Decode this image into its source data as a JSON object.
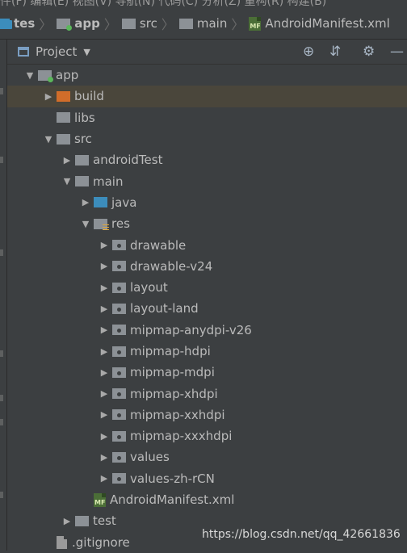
{
  "menubar": {
    "partial_text": "件(F)   编辑(E)   视图(V)   导航(N)   代码(C)   分析(Z)   重构(R)   构建(B)"
  },
  "breadcrumb": [
    {
      "label": "tes",
      "icon": "folder-icon",
      "bold": true
    },
    {
      "label": "app",
      "icon": "module-folder-icon",
      "bold": true
    },
    {
      "label": "src",
      "icon": "folder-icon",
      "bold": false
    },
    {
      "label": "main",
      "icon": "folder-icon",
      "bold": false
    },
    {
      "label": "AndroidManifest.xml",
      "icon": "manifest-file-icon",
      "bold": false
    }
  ],
  "panel": {
    "title": "Project",
    "tools": [
      "locate-icon",
      "collapse-all-icon",
      "gear-icon",
      "minimize-icon"
    ]
  },
  "tree": [
    {
      "label": "app",
      "depth": 0,
      "arrow": "expanded",
      "icon": "module-folder"
    },
    {
      "label": "build",
      "depth": 1,
      "arrow": "collapsed",
      "icon": "orange-folder",
      "selected": true
    },
    {
      "label": "libs",
      "depth": 1,
      "arrow": "none",
      "icon": "folder"
    },
    {
      "label": "src",
      "depth": 1,
      "arrow": "expanded",
      "icon": "folder"
    },
    {
      "label": "androidTest",
      "depth": 2,
      "arrow": "collapsed",
      "icon": "folder"
    },
    {
      "label": "main",
      "depth": 2,
      "arrow": "expanded",
      "icon": "folder"
    },
    {
      "label": "java",
      "depth": 3,
      "arrow": "collapsed",
      "icon": "blue-folder"
    },
    {
      "label": "res",
      "depth": 3,
      "arrow": "expanded",
      "icon": "res-folder"
    },
    {
      "label": "drawable",
      "depth": 4,
      "arrow": "collapsed",
      "icon": "package-folder"
    },
    {
      "label": "drawable-v24",
      "depth": 4,
      "arrow": "collapsed",
      "icon": "package-folder"
    },
    {
      "label": "layout",
      "depth": 4,
      "arrow": "collapsed",
      "icon": "package-folder"
    },
    {
      "label": "layout-land",
      "depth": 4,
      "arrow": "collapsed",
      "icon": "package-folder"
    },
    {
      "label": "mipmap-anydpi-v26",
      "depth": 4,
      "arrow": "collapsed",
      "icon": "package-folder"
    },
    {
      "label": "mipmap-hdpi",
      "depth": 4,
      "arrow": "collapsed",
      "icon": "package-folder"
    },
    {
      "label": "mipmap-mdpi",
      "depth": 4,
      "arrow": "collapsed",
      "icon": "package-folder"
    },
    {
      "label": "mipmap-xhdpi",
      "depth": 4,
      "arrow": "collapsed",
      "icon": "package-folder"
    },
    {
      "label": "mipmap-xxhdpi",
      "depth": 4,
      "arrow": "collapsed",
      "icon": "package-folder"
    },
    {
      "label": "mipmap-xxxhdpi",
      "depth": 4,
      "arrow": "collapsed",
      "icon": "package-folder"
    },
    {
      "label": "values",
      "depth": 4,
      "arrow": "collapsed",
      "icon": "package-folder"
    },
    {
      "label": "values-zh-rCN",
      "depth": 4,
      "arrow": "collapsed",
      "icon": "package-folder"
    },
    {
      "label": "AndroidManifest.xml",
      "depth": 3,
      "arrow": "none",
      "icon": "manifest-file"
    },
    {
      "label": "test",
      "depth": 2,
      "arrow": "collapsed",
      "icon": "folder"
    },
    {
      "label": ".gitignore",
      "depth": 1,
      "arrow": "none",
      "icon": "text-file"
    }
  ],
  "watermark": "https://blog.csdn.net/qq_42661836",
  "colors": {
    "background": "#3c3f41",
    "selection": "#4a463b",
    "text": "#bbbbbb",
    "build_folder": "#d16d2a",
    "java_folder": "#3c8dbc"
  }
}
